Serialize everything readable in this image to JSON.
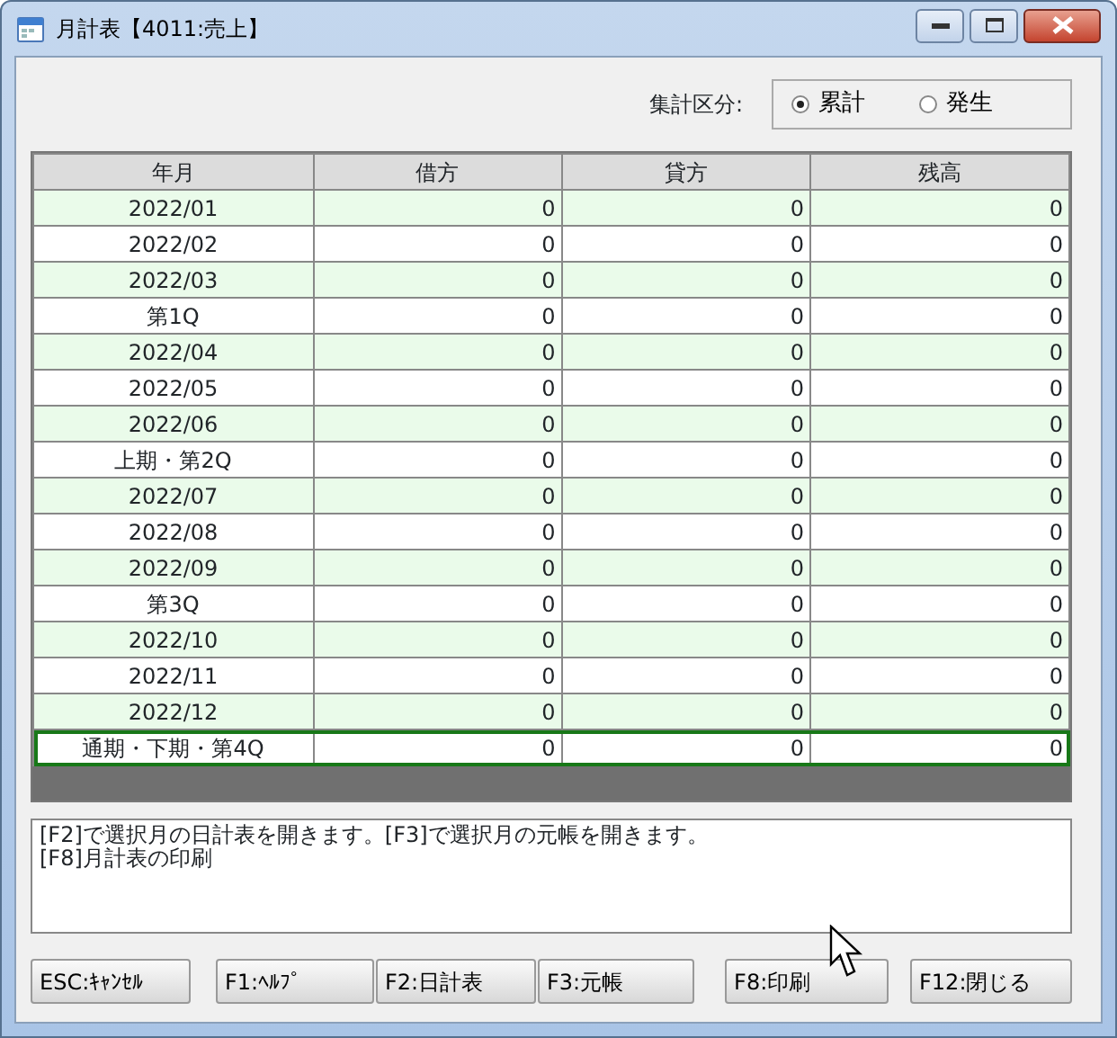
{
  "window": {
    "title": "月計表【4011:売上】"
  },
  "aggregation": {
    "label": "集計区分:",
    "options": [
      {
        "label": "累計",
        "selected": true
      },
      {
        "label": "発生",
        "selected": false
      }
    ]
  },
  "table": {
    "columns": [
      "年月",
      "借方",
      "貸方",
      "残高"
    ],
    "rows": [
      {
        "cells": [
          "2022/01",
          "0",
          "0",
          "0"
        ],
        "selected": false
      },
      {
        "cells": [
          "2022/02",
          "0",
          "0",
          "0"
        ],
        "selected": false
      },
      {
        "cells": [
          "2022/03",
          "0",
          "0",
          "0"
        ],
        "selected": false
      },
      {
        "cells": [
          "第1Q",
          "0",
          "0",
          "0"
        ],
        "selected": false
      },
      {
        "cells": [
          "2022/04",
          "0",
          "0",
          "0"
        ],
        "selected": false
      },
      {
        "cells": [
          "2022/05",
          "0",
          "0",
          "0"
        ],
        "selected": false
      },
      {
        "cells": [
          "2022/06",
          "0",
          "0",
          "0"
        ],
        "selected": false
      },
      {
        "cells": [
          "上期・第2Q",
          "0",
          "0",
          "0"
        ],
        "selected": false
      },
      {
        "cells": [
          "2022/07",
          "0",
          "0",
          "0"
        ],
        "selected": false
      },
      {
        "cells": [
          "2022/08",
          "0",
          "0",
          "0"
        ],
        "selected": false
      },
      {
        "cells": [
          "2022/09",
          "0",
          "0",
          "0"
        ],
        "selected": false
      },
      {
        "cells": [
          "第3Q",
          "0",
          "0",
          "0"
        ],
        "selected": false
      },
      {
        "cells": [
          "2022/10",
          "0",
          "0",
          "0"
        ],
        "selected": false
      },
      {
        "cells": [
          "2022/11",
          "0",
          "0",
          "0"
        ],
        "selected": false
      },
      {
        "cells": [
          "2022/12",
          "0",
          "0",
          "0"
        ],
        "selected": false
      },
      {
        "cells": [
          "通期・下期・第4Q",
          "0",
          "0",
          "0"
        ],
        "selected": true
      }
    ]
  },
  "message": [
    "[F2]で選択月の日計表を開きます。[F3]で選択月の元帳を開きます。",
    "[F8]月計表の印刷"
  ],
  "buttons": [
    "ESC:ｷｬﾝｾﾙ",
    "F1:ﾍﾙﾌﾟ",
    "F2:日計表",
    "F3:元帳",
    "F8:印刷",
    "F12:閉じる"
  ]
}
